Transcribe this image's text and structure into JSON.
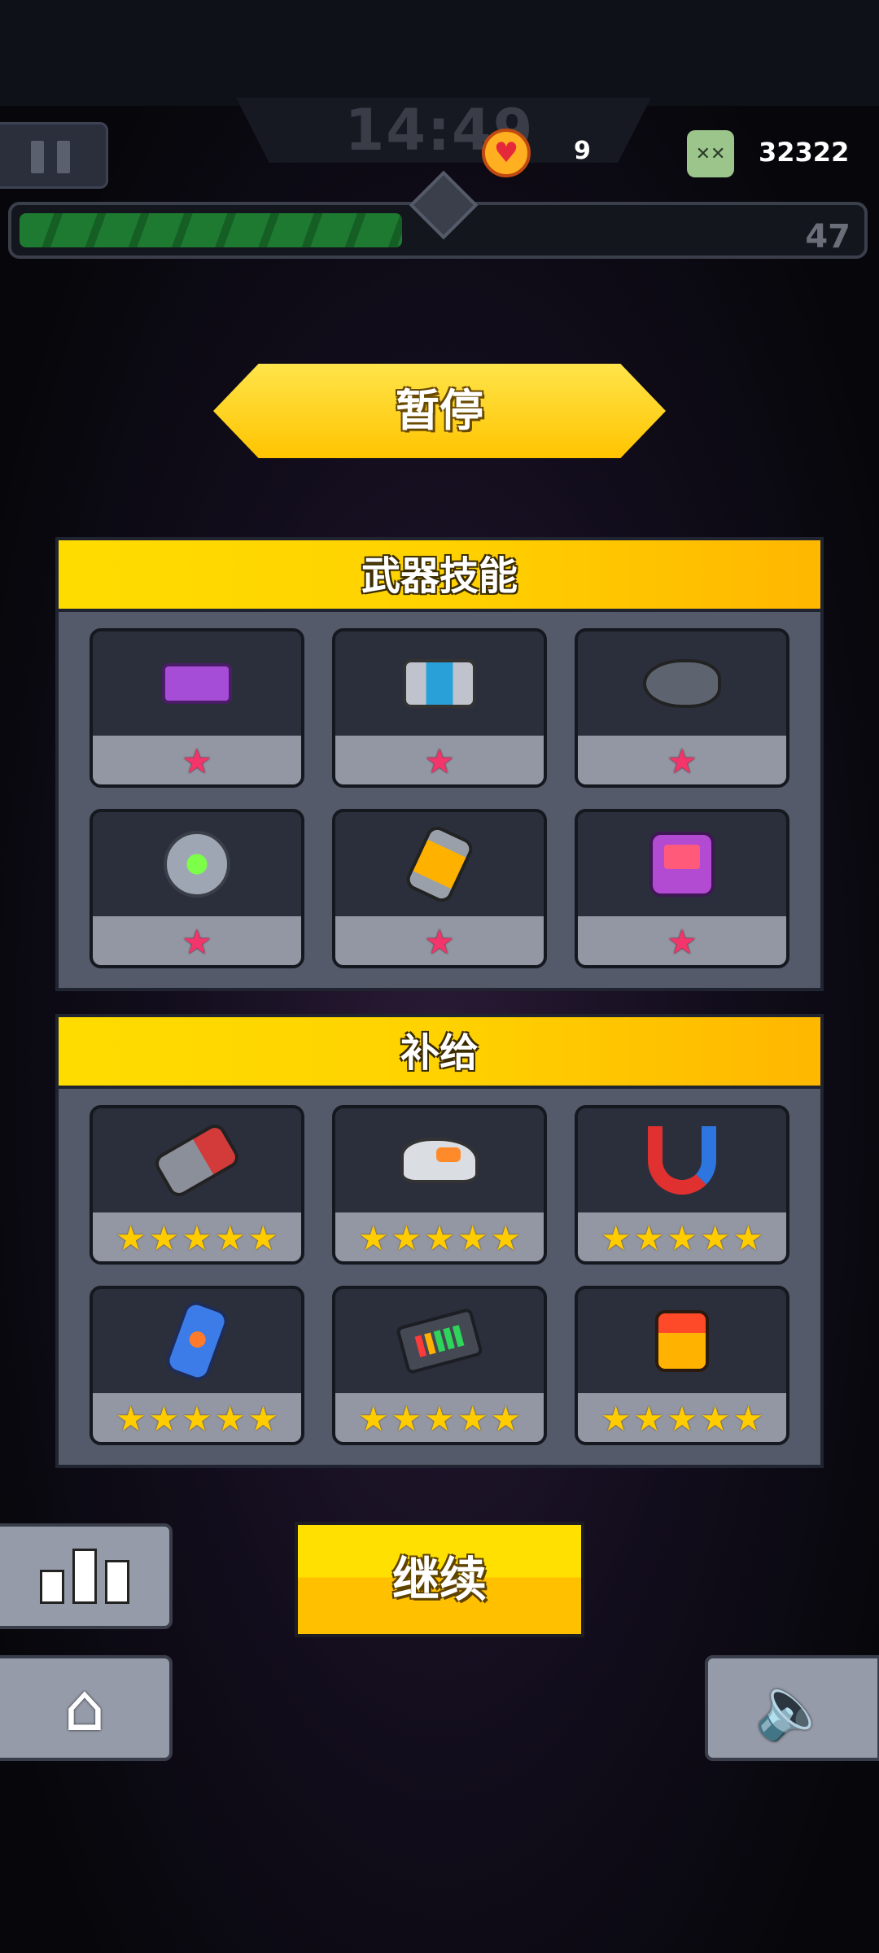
{
  "hud": {
    "timer": "14:49",
    "lives": "9",
    "kills": "32322",
    "level": "47",
    "xp_progress": 0.48
  },
  "pause_title": "暂停",
  "weapons_panel": {
    "title": "武器技能",
    "items": [
      {
        "icon": "purple-blaster-icon",
        "stars": 1
      },
      {
        "icon": "drone-turret-icon",
        "stars": 1
      },
      {
        "icon": "shark-rocket-icon",
        "stars": 1
      },
      {
        "icon": "energy-orb-icon",
        "stars": 1
      },
      {
        "icon": "battery-grenade-icon",
        "stars": 1
      },
      {
        "icon": "game-console-icon",
        "stars": 1
      }
    ]
  },
  "supply_panel": {
    "title": "补给",
    "items": [
      {
        "icon": "robot-arm-icon",
        "stars": 5
      },
      {
        "icon": "sneaker-icon",
        "stars": 5
      },
      {
        "icon": "magnet-icon",
        "stars": 5
      },
      {
        "icon": "potion-bottle-icon",
        "stars": 5
      },
      {
        "icon": "power-bank-icon",
        "stars": 5
      },
      {
        "icon": "canister-icon",
        "stars": 5
      }
    ]
  },
  "buttons": {
    "continue": "继续"
  },
  "icons": {
    "pause": "pause-icon",
    "stats": "bar-chart-icon",
    "home": "home-icon",
    "sound": "speaker-icon"
  },
  "colors": {
    "accent_yellow": "#ffd200",
    "star_pink": "#f2356a",
    "star_gold": "#ffcc00",
    "xp_green": "#1d7a30"
  }
}
